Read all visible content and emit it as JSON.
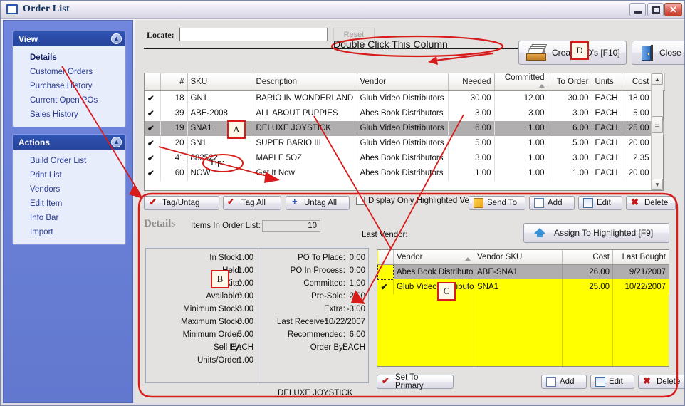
{
  "window": {
    "title": "Order List",
    "icon": "window-icon",
    "minimize": "–",
    "maximize": "□",
    "close": "✕"
  },
  "sidebar": {
    "panels": [
      {
        "title": "View",
        "collapse_icon": "chevron-up-icon",
        "items": [
          {
            "label": "Details",
            "active": true
          },
          {
            "label": "Customer Orders",
            "active": false
          },
          {
            "label": "Purchase History",
            "active": false
          },
          {
            "label": "Current Open POs",
            "active": false
          },
          {
            "label": "Sales History",
            "active": false
          }
        ]
      },
      {
        "title": "Actions",
        "collapse_icon": "chevron-up-icon",
        "items": [
          {
            "label": "Build Order List",
            "active": false
          },
          {
            "label": "Print List",
            "active": false
          },
          {
            "label": "Vendors",
            "active": false
          },
          {
            "label": "Edit Item",
            "active": false
          },
          {
            "label": "Info Bar",
            "active": false
          },
          {
            "label": "Import",
            "active": false
          }
        ]
      }
    ]
  },
  "toolbar": {
    "locate_label": "Locate:",
    "locate_value": "",
    "locate_placeholder": "",
    "reset_label": "Reset",
    "create_po_label": "Create PO's [F10]",
    "close_label": "Close"
  },
  "order_grid": {
    "columns": [
      "",
      "#",
      "SKU",
      "Description",
      "Vendor",
      "Needed",
      "Committed",
      "To Order",
      "Units",
      "Cost"
    ],
    "sorted_column": "Committed",
    "sort_direction": "asc",
    "rows": [
      {
        "tag": "✔",
        "num": "18",
        "sku": "GN1",
        "description": "BARIO IN WONDERLAND",
        "vendor": "Glub Video Distributors",
        "needed": "30.00",
        "committed": "12.00",
        "to_order": "30.00",
        "units": "EACH",
        "cost": "18.00",
        "selected": false
      },
      {
        "tag": "✔",
        "num": "39",
        "sku": "ABE-2008",
        "description": "ALL ABOUT PUPPIES",
        "vendor": "Abes Book Distributors",
        "needed": "3.00",
        "committed": "3.00",
        "to_order": "3.00",
        "units": "EACH",
        "cost": "5.00",
        "selected": false
      },
      {
        "tag": "✔",
        "num": "19",
        "sku": "SNA1",
        "description": "DELUXE JOYSTICK",
        "vendor": "Glub Video Distributors",
        "needed": "6.00",
        "committed": "1.00",
        "to_order": "6.00",
        "units": "EACH",
        "cost": "25.00",
        "selected": true
      },
      {
        "tag": "✔",
        "num": "20",
        "sku": "SN1",
        "description": "SUPER BARIO III",
        "vendor": "Glub Video Distributors",
        "needed": "5.00",
        "committed": "1.00",
        "to_order": "5.00",
        "units": "EACH",
        "cost": "20.00",
        "selected": false
      },
      {
        "tag": "✔",
        "num": "41",
        "sku": "882522",
        "description": "MAPLE 5OZ",
        "vendor": "Abes Book Distributors",
        "needed": "3.00",
        "committed": "1.00",
        "to_order": "3.00",
        "units": "EACH",
        "cost": "2.35",
        "selected": false
      },
      {
        "tag": "✔",
        "num": "60",
        "sku": "NOW",
        "description": "Get It Now!",
        "vendor": "Abes Book Distributors",
        "needed": "1.00",
        "committed": "1.00",
        "to_order": "1.00",
        "units": "EACH",
        "cost": "20.00",
        "selected": false
      }
    ]
  },
  "grid_actions": {
    "tag_untag": "Tag/Untag",
    "tag_all": "Tag All",
    "untag_all": "Untag All",
    "display_only_highlighted": "Display Only Highlighted Vendor",
    "send_to": "Send To",
    "add": "Add",
    "edit": "Edit",
    "delete": "Delete"
  },
  "details": {
    "title": "Details",
    "items_in_order_list_label": "Items In Order List:",
    "items_in_order_list_value": "10",
    "last_vendor_label": "Last Vendor:",
    "caption": "DELUXE JOYSTICK",
    "left_fields": [
      {
        "label": "In Stock:",
        "value": "1.00"
      },
      {
        "label": "Held:",
        "value": "1.00"
      },
      {
        "label": "For Kits:",
        "value": "0.00"
      },
      {
        "label": "Available:",
        "value": "0.00"
      },
      {
        "label": "Minimum Stock:",
        "value": "3.00"
      },
      {
        "label": "Maximum Stock:",
        "value": "0.00"
      },
      {
        "label": "Minimum Order:",
        "value": "5.00"
      },
      {
        "label": "Sell By:",
        "value": "EACH"
      },
      {
        "label": "Units/Order:",
        "value": "1.00"
      }
    ],
    "right_fields": [
      {
        "label": "PO To Place:",
        "value": "0.00"
      },
      {
        "label": "PO In Process:",
        "value": "0.00"
      },
      {
        "label": "Committed:",
        "value": "1.00"
      },
      {
        "label": "Pre-Sold:",
        "value": "2.00"
      },
      {
        "label": "Extra:",
        "value": "-3.00"
      },
      {
        "label": "Last Received:",
        "value": "10/22/2007"
      },
      {
        "label": "Recommended:",
        "value": "6.00"
      },
      {
        "label": "Order By:",
        "value": "EACH"
      }
    ]
  },
  "vendor_grid": {
    "assign_button": "Assign To Highlighted [F9]",
    "columns": [
      "",
      "Vendor",
      "Vendor SKU",
      "Cost",
      "Last Bought"
    ],
    "sorted_column": "Vendor",
    "sort_direction": "asc",
    "rows": [
      {
        "tag": "",
        "vendor": "Abes Book Distributors",
        "vendor_sku": "ABE-SNA1",
        "cost": "26.00",
        "last_bought": "9/21/2007",
        "selected": true
      },
      {
        "tag": "✔",
        "vendor": "Glub Video Distributors",
        "vendor_sku": "SNA1",
        "cost": "25.00",
        "last_bought": "10/22/2007",
        "selected": false
      }
    ],
    "set_to_primary": "Set To Primary",
    "add": "Add",
    "edit": "Edit",
    "delete": "Delete"
  },
  "annotations": {
    "callouts": [
      {
        "id": "A",
        "label": "A"
      },
      {
        "id": "B",
        "label": "B"
      },
      {
        "id": "C",
        "label": "C"
      },
      {
        "id": "D",
        "label": "D"
      }
    ],
    "double_click_text": "Double Click This Column",
    "tip_text": "Tip:",
    "accent_color": "#d81b1b"
  },
  "colors": {
    "sidebar_blue": "#6b80d9",
    "panel_header": "#2a4aa5",
    "highlight_row": "#b0aeae",
    "vendor_grid_yellow": "#ffff00",
    "annotation_red": "#d81b1b"
  }
}
